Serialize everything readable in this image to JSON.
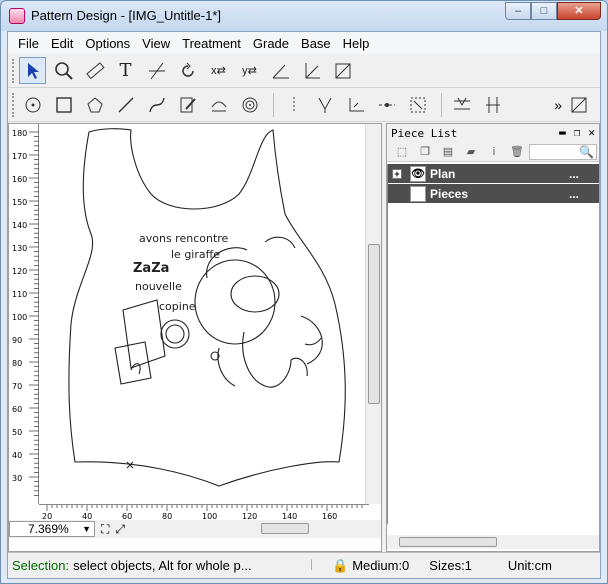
{
  "window": {
    "title": "Pattern Design - [IMG_Untitle-1*]",
    "controls": {
      "minimize": "–",
      "maximize": "□",
      "close": "✕"
    }
  },
  "menubar": {
    "items": [
      {
        "label": "File",
        "key": "F"
      },
      {
        "label": "Edit",
        "key": "E"
      },
      {
        "label": "Options",
        "key": "O"
      },
      {
        "label": "View",
        "key": "V"
      },
      {
        "label": "Treatment",
        "key": "T"
      },
      {
        "label": "Grade",
        "key": "G"
      },
      {
        "label": "Base",
        "key": "B"
      },
      {
        "label": "Help",
        "key": "H"
      }
    ]
  },
  "toolbar1": {
    "tools": [
      "select-arrow-icon",
      "zoom-icon",
      "ruler-icon",
      "text-icon",
      "cut-line-icon",
      "rotate-icon",
      "xy-swap-icon",
      "yx-swap-icon",
      "angle-icon",
      "axis-icon",
      "diagonal-icon"
    ]
  },
  "toolbar2": {
    "tools": [
      "circle-icon",
      "rectangle-icon",
      "polygon-icon",
      "line-icon",
      "curve-icon",
      "pen-icon",
      "arc-icon",
      "spiral-icon",
      "point-icon",
      "notch-icon",
      "corner-icon",
      "split-icon",
      "measure-icon",
      "dart-icon",
      "grain-icon",
      "grade-icon"
    ],
    "more": "»"
  },
  "rulers": {
    "vertical": [
      "180",
      "170",
      "160",
      "150",
      "140",
      "130",
      "120",
      "110",
      "100",
      "90",
      "80",
      "70",
      "60",
      "50",
      "40",
      "30"
    ],
    "horizontal": [
      "20",
      "40",
      "60",
      "80",
      "100",
      "120",
      "140",
      "160"
    ]
  },
  "canvas": {
    "zoom": "7.369%",
    "drawing_text": [
      "avons rencontre",
      "le giraffe",
      "ZaZa",
      "nouvelle",
      "copine"
    ]
  },
  "panel": {
    "title": "Piece List",
    "rows": [
      {
        "label": "Plan",
        "dots": "...",
        "visible": true,
        "expandable": true
      },
      {
        "label": "Pieces",
        "dots": "...",
        "visible": false,
        "expandable": false
      }
    ]
  },
  "statusbar": {
    "label": "Selection:",
    "text": "select objects, Alt for whole p...",
    "medium": "Medium:0",
    "sizes": "Sizes:1",
    "unit": "Unit:cm"
  },
  "colors": {
    "selected_row": "#4e4e4e",
    "status_label": "#006a00",
    "title_bar": "#c5d8ef"
  }
}
